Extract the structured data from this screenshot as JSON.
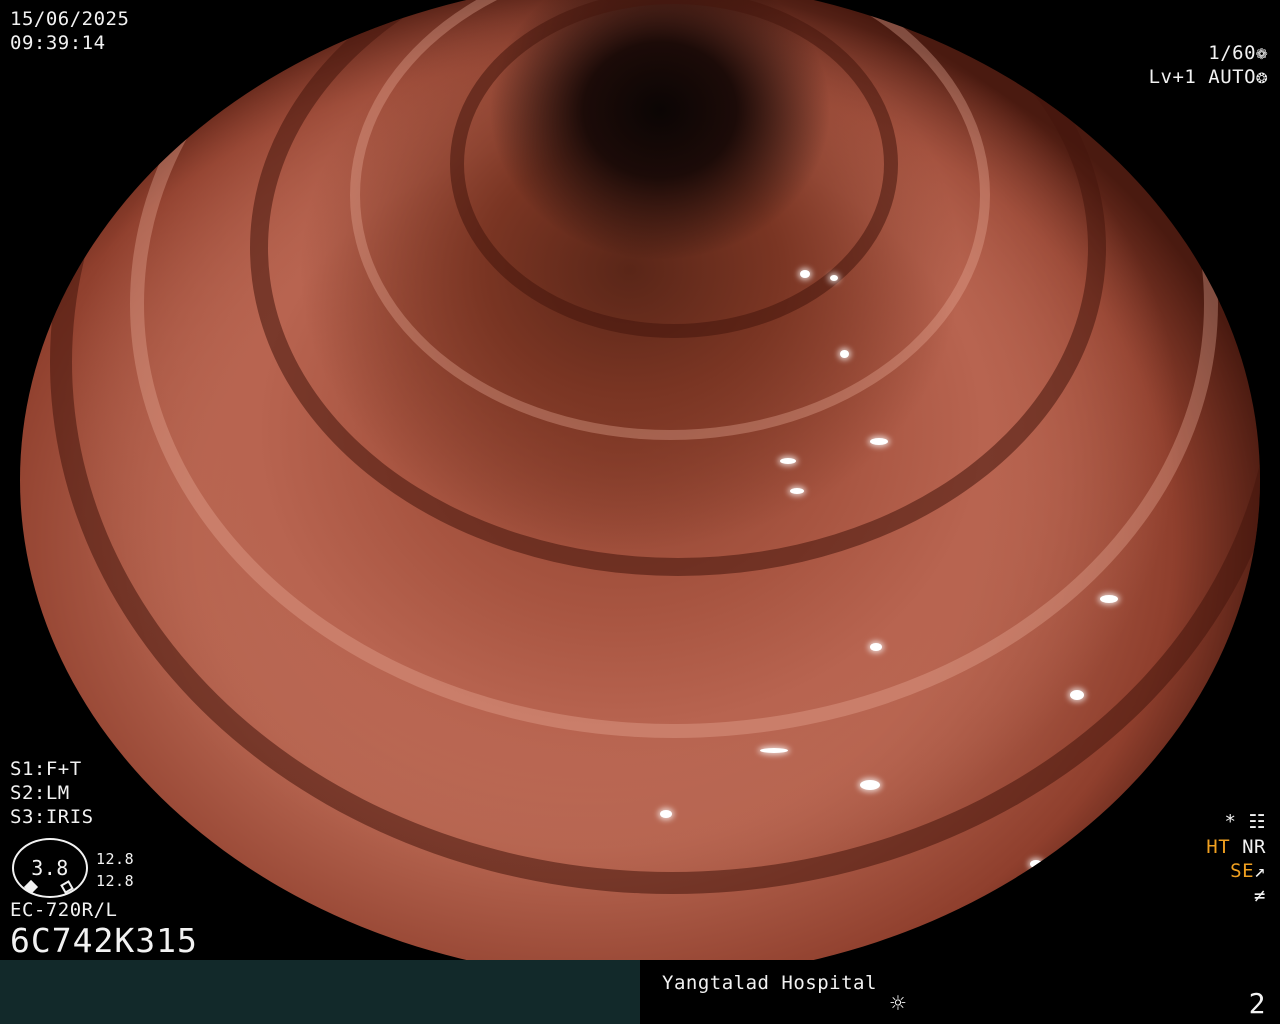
{
  "header": {
    "date": "15/06/2025",
    "time": "09:39:14",
    "shutter": "1/60",
    "shutter_icon": "shutter-icon",
    "level": "Lv+1",
    "exposure_mode": "AUTO",
    "exposure_icon": "aperture-icon"
  },
  "settings": {
    "s1": "S1:F+T",
    "s2": "S2:LM",
    "s3": "S3:IRIS"
  },
  "gauge": {
    "value": "3.8",
    "upper": "12.8",
    "lower": "12.8"
  },
  "scope": {
    "model": "EC-720R/L",
    "serial": "6C742K315"
  },
  "right_status": {
    "star": "*",
    "star_icon": "settings-sliders-icon",
    "ht": "HT",
    "nr": "NR",
    "se": "SE",
    "se_icon": "structure-enhance-icon",
    "freeze_icon": "freeze-off-icon"
  },
  "footer": {
    "hospital": "Yangtalad Hospital",
    "light_icon": "sun-icon",
    "page": "2"
  },
  "colors": {
    "accent_orange": "#f0a020",
    "footer_teal": "#12292a"
  }
}
